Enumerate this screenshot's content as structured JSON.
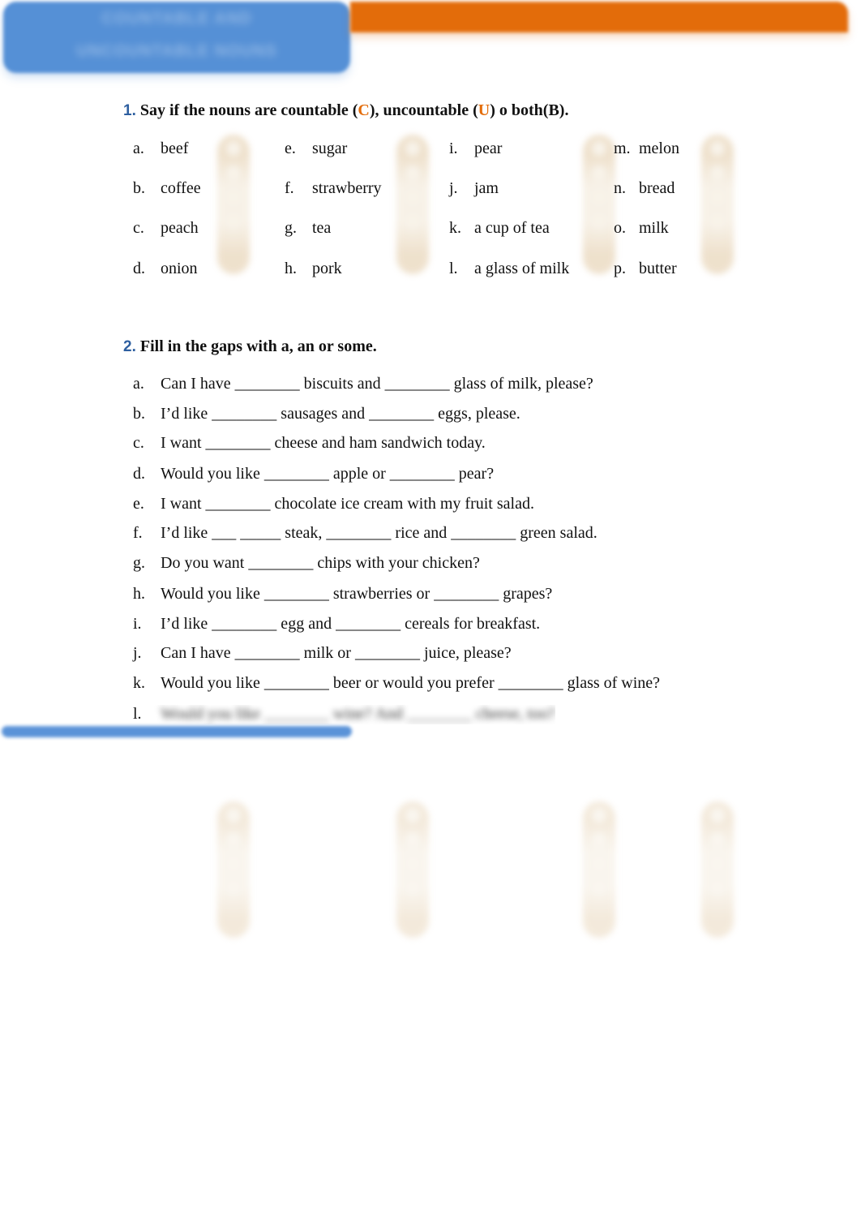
{
  "header": {
    "title_line_1": "COUNTABLE AND",
    "title_line_2": "UNCOUNTABLE NOUNS",
    "colors": {
      "banner_blue": "#5590d6",
      "banner_orange": "#e36c0a",
      "number_blue": "#2e5fa0",
      "accent_orange": "#e36c0a"
    }
  },
  "exercise1": {
    "number": "1.",
    "instruction_parts": {
      "pre": "Say if the nouns are countable (",
      "c": "C",
      "mid": "), uncountable (",
      "u": "U",
      "post": ") o both(B)."
    },
    "columns": [
      [
        {
          "letter": "a.",
          "word": "beef"
        },
        {
          "letter": "b.",
          "word": "coffee"
        },
        {
          "letter": "c.",
          "word": "peach"
        },
        {
          "letter": "d.",
          "word": "onion"
        }
      ],
      [
        {
          "letter": "e.",
          "word": "sugar"
        },
        {
          "letter": "f.",
          "word": "strawberry"
        },
        {
          "letter": "g.",
          "word": "tea"
        },
        {
          "letter": "h.",
          "word": "pork"
        }
      ],
      [
        {
          "letter": "i.",
          "word": "pear"
        },
        {
          "letter": "j.",
          "word": "jam"
        },
        {
          "letter": "k.",
          "word": "a cup of tea"
        },
        {
          "letter": "l.",
          "word": "a glass of milk"
        }
      ],
      [
        {
          "letter": "m.",
          "word": "melon"
        },
        {
          "letter": "n.",
          "word": "bread"
        },
        {
          "letter": "o.",
          "word": "milk"
        },
        {
          "letter": "p.",
          "word": "butter"
        }
      ]
    ]
  },
  "exercise2": {
    "number": "2.",
    "instruction": "Fill in the gaps with a, an or some.",
    "items": [
      {
        "letter": "a.",
        "text": "Can I have ________ biscuits and ________ glass of milk, please?"
      },
      {
        "letter": "b.",
        "text": "I’d like ________ sausages and ________ eggs, please."
      },
      {
        "letter": "c.",
        "text": "I want ________ cheese and ham sandwich today."
      },
      {
        "letter": "d.",
        "text": "Would you like ________ apple or ________ pear?"
      },
      {
        "letter": "e.",
        "text": "I want ________ chocolate ice cream with my fruit salad."
      },
      {
        "letter": "f.",
        "text": "I’d like ___ _____ steak, ________ rice and ________ green salad."
      },
      {
        "letter": "g.",
        "text": "Do you want ________ chips with your chicken?"
      },
      {
        "letter": "h.",
        "text": "Would you like ________ strawberries or ________ grapes?"
      },
      {
        "letter": "i.",
        "text": "I’d like ________ egg and ________ cereals for breakfast."
      },
      {
        "letter": "j.",
        "text": "Can I have ________ milk or ________ juice, please?"
      },
      {
        "letter": "k.",
        "text": "Would you like ________ beer or would you prefer ________ glass of wine?"
      },
      {
        "letter": "l.",
        "text": "Would you like ________ wine? And ________ cheese, too?"
      }
    ]
  }
}
